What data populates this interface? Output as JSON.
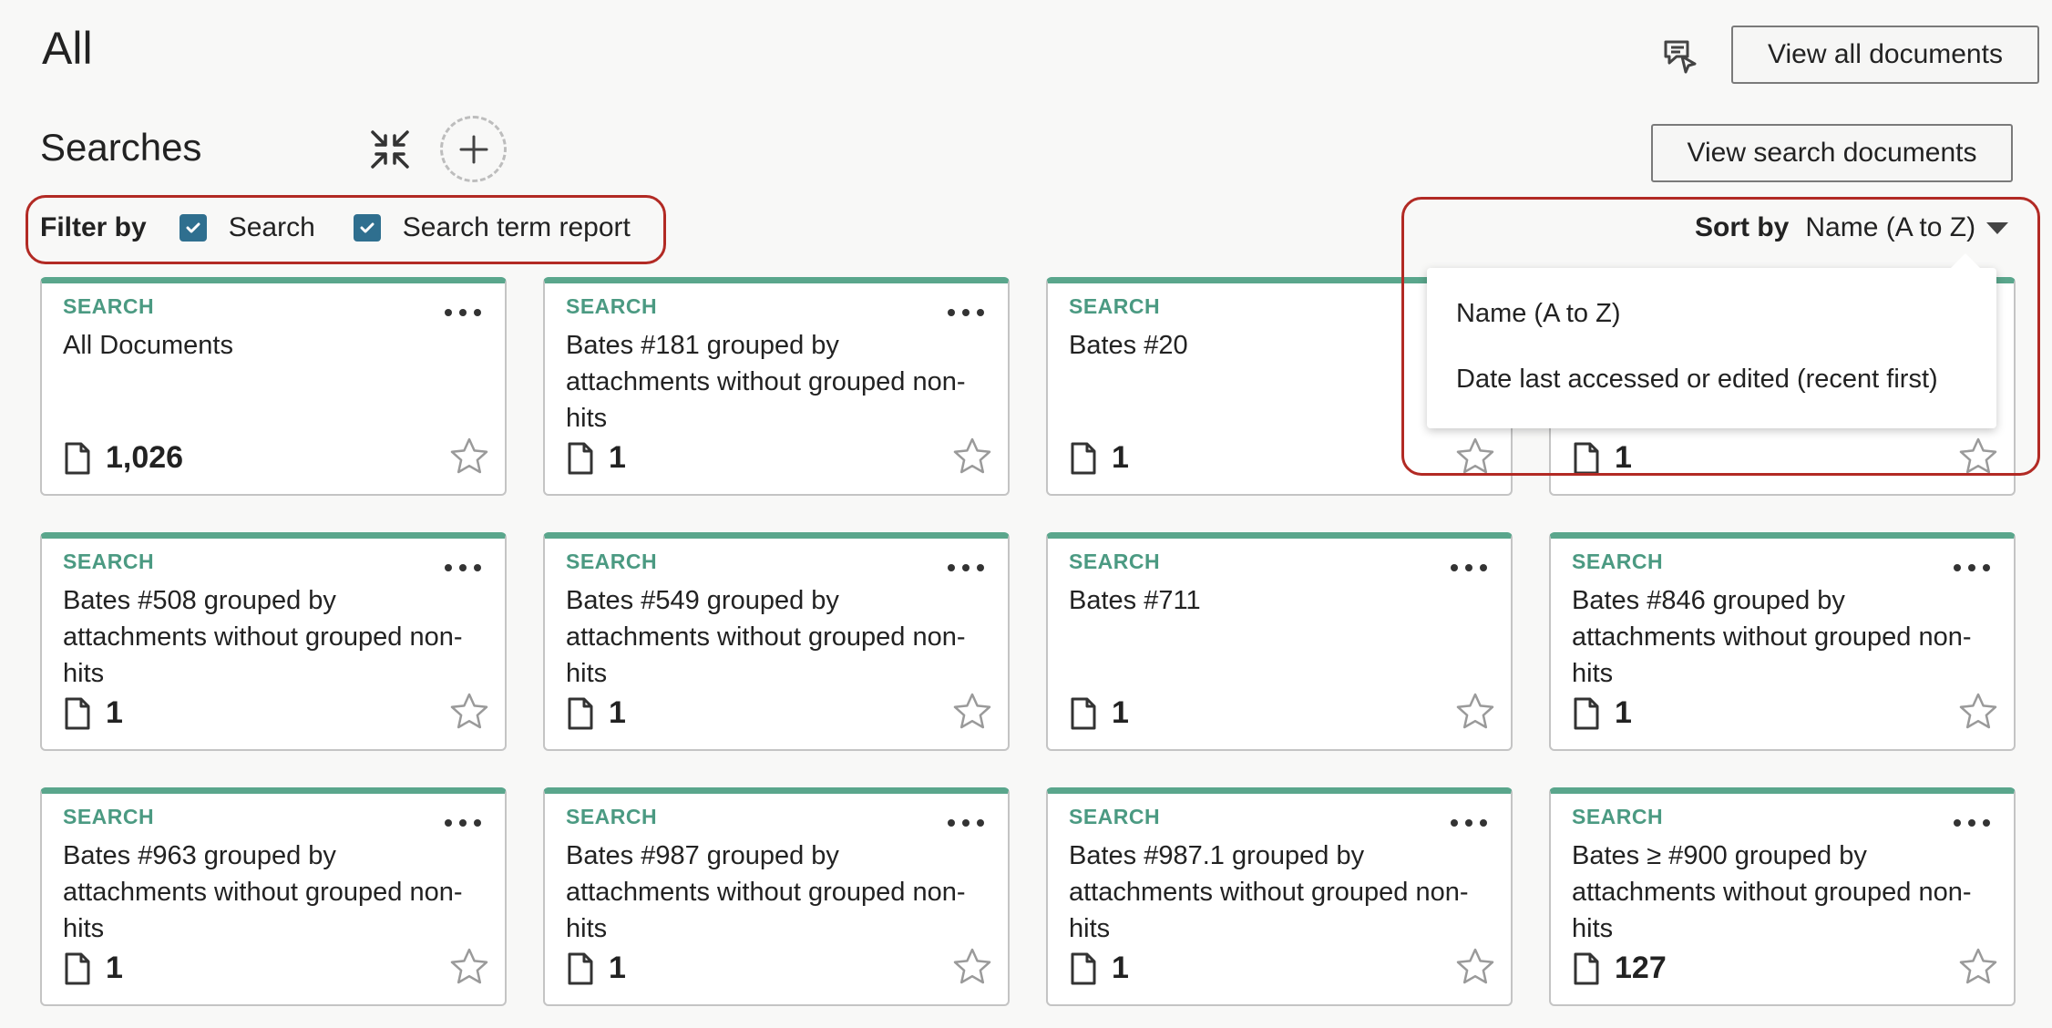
{
  "header": {
    "title": "All",
    "view_all_label": "View all documents",
    "comment_icon": "comment-cursor-icon"
  },
  "searches": {
    "title": "Searches",
    "collapse_icon": "collapse-arrows-icon",
    "add_icon": "plus-icon",
    "view_search_label": "View search documents"
  },
  "filter": {
    "label": "Filter by",
    "options": [
      {
        "label": "Search",
        "checked": true
      },
      {
        "label": "Search term report",
        "checked": true
      }
    ]
  },
  "sort": {
    "label": "Sort by",
    "value": "Name (A to Z)",
    "options": [
      "Name (A to Z)",
      "Date last accessed or edited (recent first)"
    ]
  },
  "colors": {
    "accent": "#5aa68c",
    "highlight": "#b22a24",
    "checkbox": "#2f6f8f"
  },
  "cards": [
    {
      "type": "SEARCH",
      "title": "All Documents",
      "count": "1,026"
    },
    {
      "type": "SEARCH",
      "title": "Bates #181 grouped by attachments without grouped non-hits",
      "count": "1"
    },
    {
      "type": "SEARCH",
      "title": "Bates #20",
      "count": "1"
    },
    {
      "type": "",
      "title": "",
      "count": "1"
    },
    {
      "type": "SEARCH",
      "title": "Bates #508 grouped by attachments without grouped non-hits",
      "count": "1"
    },
    {
      "type": "SEARCH",
      "title": "Bates #549 grouped by attachments without grouped non-hits",
      "count": "1"
    },
    {
      "type": "SEARCH",
      "title": "Bates #711",
      "count": "1"
    },
    {
      "type": "SEARCH",
      "title": "Bates #846 grouped by attachments without grouped non-hits",
      "count": "1"
    },
    {
      "type": "SEARCH",
      "title": "Bates #963 grouped by attachments without grouped non-hits",
      "count": "1"
    },
    {
      "type": "SEARCH",
      "title": "Bates #987 grouped by attachments without grouped non-hits",
      "count": "1"
    },
    {
      "type": "SEARCH",
      "title": "Bates #987.1 grouped by attachments without grouped non-hits",
      "count": "1"
    },
    {
      "type": "SEARCH",
      "title": "Bates ≥ #900 grouped by attachments without grouped non-hits",
      "count": "127"
    }
  ]
}
